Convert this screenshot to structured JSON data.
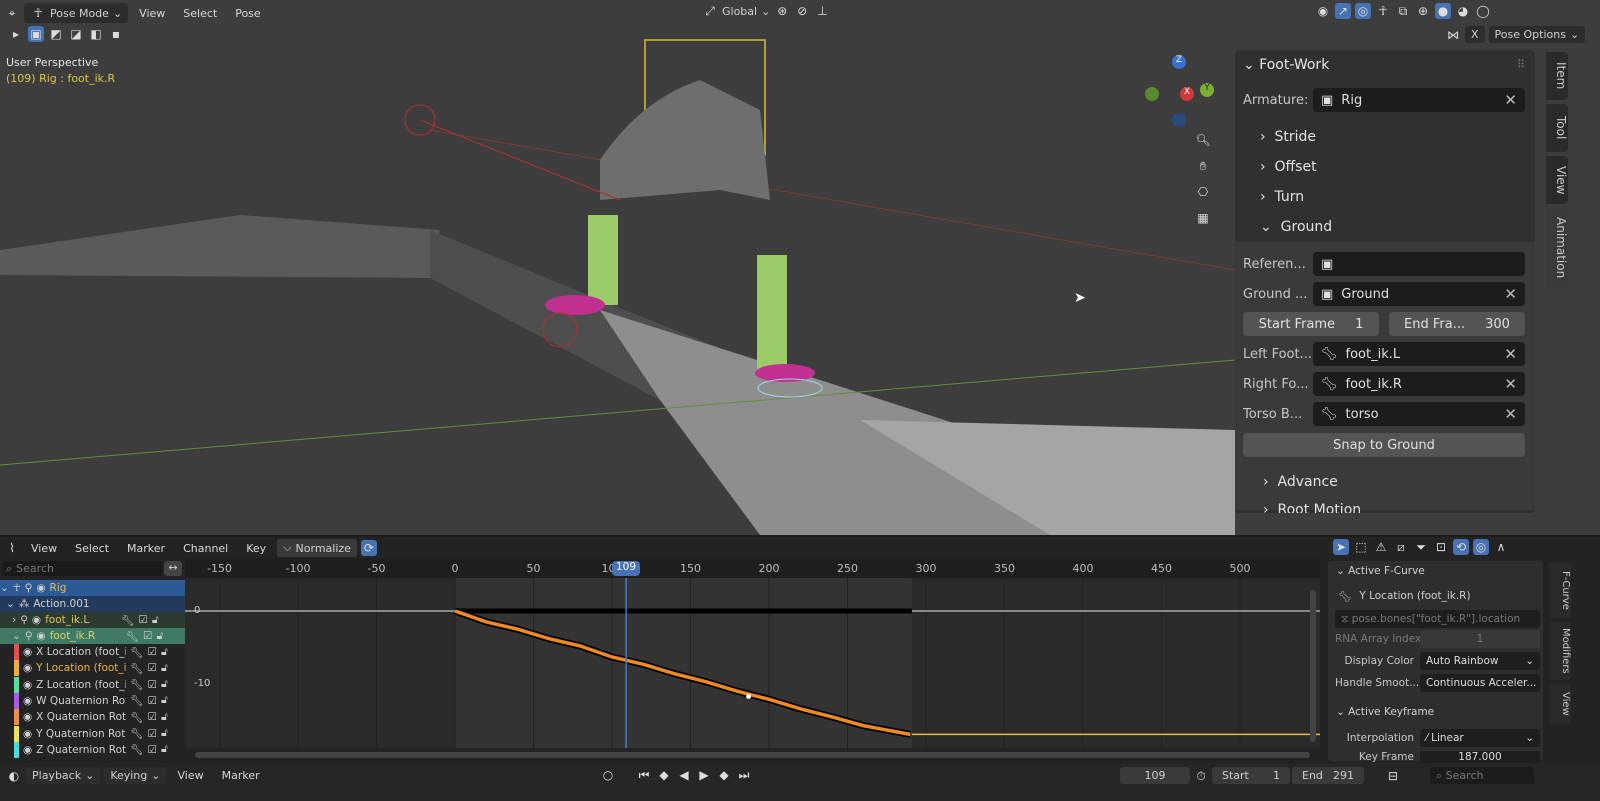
{
  "viewport_header": {
    "mode": "Pose Mode",
    "menus": [
      "View",
      "Select",
      "Pose"
    ],
    "orientation": "Global",
    "pose_options": "Pose Options",
    "x_label": "X"
  },
  "viewport_info": {
    "perspective": "User Perspective",
    "object": "(109) Rig : foot_ik.R"
  },
  "gizmo": {
    "z": "Z",
    "x": "X",
    "y": "Y"
  },
  "npanel": {
    "title": "Foot-Work",
    "armature_label": "Armature:",
    "armature_value": "Rig",
    "sections": [
      "Stride",
      "Offset",
      "Turn",
      "Ground"
    ],
    "reference_label": "Referen...",
    "reference_value": "",
    "ground_label": "Ground ...",
    "ground_value": "Ground",
    "start_frame_label": "Start Frame",
    "start_frame_value": "1",
    "end_frame_label": "End Fra...",
    "end_frame_value": "300",
    "left_foot_label": "Left Foot...",
    "left_foot_value": "foot_ik.L",
    "right_foot_label": "Right Fo...",
    "right_foot_value": "foot_ik.R",
    "torso_label": "Torso B...",
    "torso_value": "torso",
    "snap_button": "Snap to Ground",
    "advance": "Advance",
    "root_motion": "Root Motion",
    "tabs": [
      "Item",
      "Tool",
      "View",
      "Animation"
    ]
  },
  "graph_header": {
    "menus": [
      "View",
      "Select",
      "Marker",
      "Channel",
      "Key"
    ],
    "normalize": "Normalize"
  },
  "channels": {
    "search_placeholder": "Search",
    "rig": "Rig",
    "action": "Action.001",
    "bone_l": "foot_ik.L",
    "bone_r": "foot_ik.R",
    "curves": [
      {
        "name": "X Location (foot_ik.R)",
        "color": "#e05050"
      },
      {
        "name": "Y Location (foot_ik.R)",
        "color": "#e8b040"
      },
      {
        "name": "Z Location (foot_ik.R)",
        "color": "#60d8a0"
      },
      {
        "name": "W Quaternion Rotation",
        "color": "#a060e0"
      },
      {
        "name": "X Quaternion Rotation",
        "color": "#e89050"
      },
      {
        "name": "Y Quaternion Rotation",
        "color": "#e8e060"
      },
      {
        "name": "Z Quaternion Rotation",
        "color": "#50d8e0"
      }
    ]
  },
  "graph": {
    "frame_ticks": [
      "-150",
      "-100",
      "-50",
      "0",
      "50",
      "100",
      "150",
      "200",
      "250",
      "300",
      "350",
      "400",
      "450",
      "500"
    ],
    "value_ticks": [
      "0",
      "-10"
    ],
    "current_frame": "109",
    "curve_points": [
      [
        0,
        0
      ],
      [
        20,
        -1.5
      ],
      [
        40,
        -2.5
      ],
      [
        60,
        -3.8
      ],
      [
        80,
        -4.8
      ],
      [
        100,
        -6.3
      ],
      [
        120,
        -7.3
      ],
      [
        140,
        -8.6
      ],
      [
        160,
        -9.7
      ],
      [
        180,
        -11
      ],
      [
        200,
        -12.1
      ],
      [
        220,
        -13.4
      ],
      [
        240,
        -14.5
      ],
      [
        260,
        -15.7
      ],
      [
        290,
        -16.9
      ],
      [
        520,
        -16.9
      ]
    ]
  },
  "fcurve_panel": {
    "title": "Active F-Curve",
    "curve": "Y Location (foot_ik.R)",
    "path": "pose.bones[\"foot_ik.R\"].location",
    "rna_label": "RNA Array Index",
    "rna_value": "1",
    "display_color_label": "Display Color",
    "display_color_value": "Auto Rainbow",
    "handle_label": "Handle Smoot...",
    "handle_value": "Continuous Acceler...",
    "keyframe_title": "Active Keyframe",
    "interp_label": "Interpolation",
    "interp_value": "Linear",
    "keyframe_label": "Key Frame",
    "keyframe_value": "187.000",
    "tabs": [
      "F-Curve",
      "Modifiers",
      "View"
    ]
  },
  "timeline": {
    "menus": [
      "Playback",
      "Keying",
      "View",
      "Marker"
    ],
    "current": "109",
    "start_label": "Start",
    "start": "1",
    "end_label": "End",
    "end": "291",
    "search_placeholder": "Search"
  }
}
